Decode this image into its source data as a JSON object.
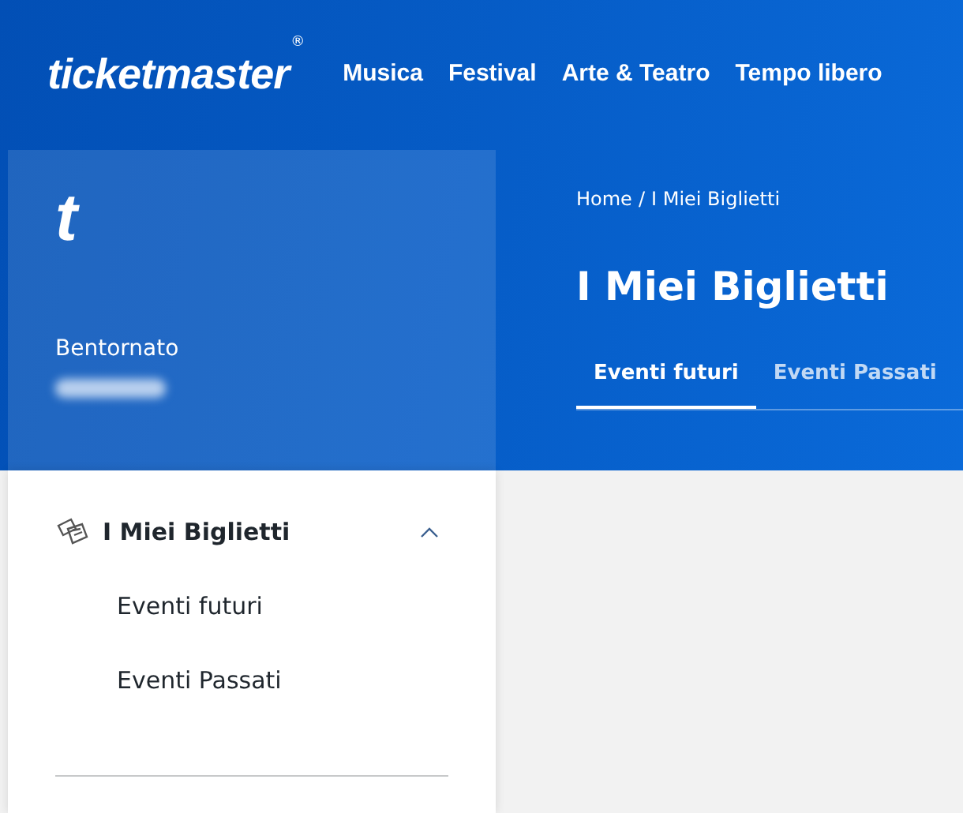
{
  "brand": {
    "wordmark": "ticketmaster",
    "mark": "®"
  },
  "nav": [
    "Musica",
    "Festival",
    "Arte & Teatro",
    "Tempo libero"
  ],
  "profile": {
    "logo": "t",
    "greeting": "Bentornato",
    "name_blurred": true
  },
  "menu": [
    {
      "label": "I Miei Biglietti",
      "expanded": true,
      "children": [
        {
          "label": "Eventi futuri"
        },
        {
          "label": "Eventi Passati"
        }
      ]
    }
  ],
  "breadcrumb": [
    "Home",
    "/",
    "I Miei Biglietti"
  ],
  "title": "I Miei Biglietti",
  "tabs": [
    {
      "label": "Eventi futuri",
      "selected": true
    },
    {
      "label": "Eventi Passati",
      "selected": false
    }
  ]
}
